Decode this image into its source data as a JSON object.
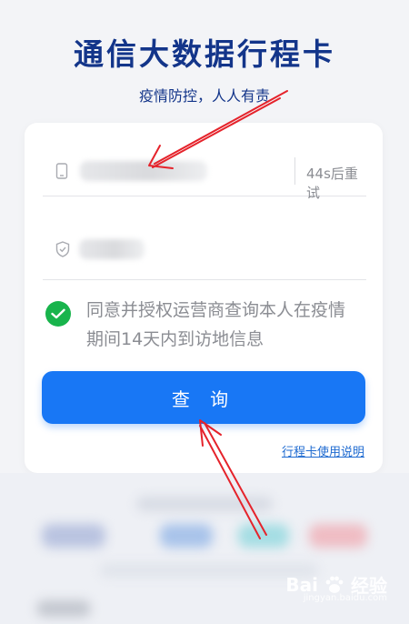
{
  "header": {
    "title": "通信大数据行程卡",
    "slogan": "疫情防控，人人有责"
  },
  "form": {
    "phone_field": {
      "icon": "phone-icon"
    },
    "resend_label": "44s后重试",
    "code_field": {
      "icon": "shield-icon"
    },
    "consent_text": "同意并授权运营商查询本人在疫情期间14天内到访地信息",
    "consent_checked": true,
    "query_button": "查 询",
    "help_link": "行程卡使用说明"
  },
  "watermark": {
    "brand": "Bai",
    "suffix": "经验",
    "sub": "jingyan.baidu.com"
  },
  "colors": {
    "title": "#13358a",
    "primary": "#1877f5",
    "check": "#18b44c",
    "annotation": "#e5232b"
  }
}
